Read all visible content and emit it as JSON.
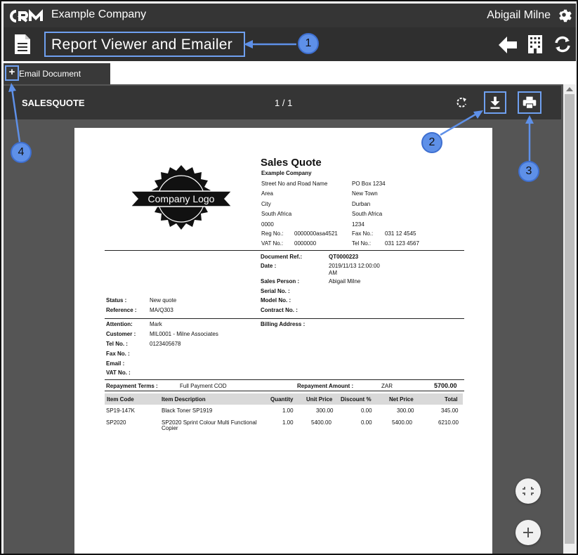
{
  "topbar": {
    "company": "Example Company",
    "user": "Abigail Milne"
  },
  "header": {
    "title": "Report Viewer and Emailer"
  },
  "tab": {
    "plus": "+",
    "label": "Email Document"
  },
  "viewer": {
    "report_name": "SALESQUOTE",
    "page_count": "1 / 1"
  },
  "callouts": [
    "1",
    "2",
    "3",
    "4"
  ],
  "doc": {
    "logo_text": "Company Logo",
    "title": "Sales Quote",
    "company": "Example Company",
    "addr_left": [
      "Street No and Road Name",
      "Area",
      "City",
      "South Africa",
      "0000"
    ],
    "addr_right": [
      "PO Box 1234",
      "New Town",
      "Durban",
      "South Africa",
      "1234"
    ],
    "reg_label": "Reg No.:",
    "reg": "0000000asa4521",
    "fax_label": "Fax No.:",
    "fax": "031 12 4545",
    "vat_label": "VAT No.:",
    "vat": "0000000",
    "tel_label": "Tel No.:",
    "tel": "031 123 4567",
    "docref_label": "Document Ref.:",
    "docref": "QT0000223",
    "date_label": "Date :",
    "date1": "2019/11/13 12:00:00",
    "date2": "AM",
    "sales_label": "Sales Person :",
    "sales": "Abigail Milne",
    "serial_label": "Serial No. :",
    "model_label": "Model No. :",
    "contract_label": "Contract No. :",
    "status_label": "Status :",
    "status": "New quote",
    "ref_label": "Reference :",
    "ref": "MA/Q303",
    "att_label": "Attention:",
    "att": "Mark",
    "cust_label": "Customer :",
    "cust": "MIL0001 - Milne Associates",
    "ctel_label": "Tel No. :",
    "ctel": "0123405678",
    "cfax_label": "Fax No. :",
    "email_label": "Email :",
    "cvat_label": "VAT No. :",
    "billing_label": "Billing Address :",
    "repay_terms_label": "Repayment Terms :",
    "repay_terms": "Full Payment COD",
    "repay_amount_label": "Repayment Amount :",
    "currency": "ZAR",
    "repay_amount": "5700.00",
    "columns": [
      "Item Code",
      "Item Description",
      "Quantity",
      "Unit Price",
      "Discount %",
      "Net Price",
      "Total"
    ],
    "rows": [
      {
        "code": "SP19-147K",
        "desc1": "Black Toner SP1919",
        "desc2": "",
        "qty": "1.00",
        "unit": "300.00",
        "disc": "0.00",
        "net": "300.00",
        "total": "345.00"
      },
      {
        "code": "SP2020",
        "desc1": "SP2020 Sprint Colour Multi Functional",
        "desc2": "Copier",
        "qty": "1.00",
        "unit": "5400.00",
        "disc": "0.00",
        "net": "5400.00",
        "total": "6210.00"
      }
    ]
  }
}
